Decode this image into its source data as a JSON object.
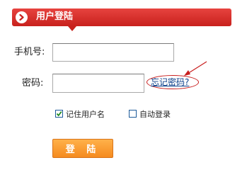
{
  "header": {
    "title": "用户登陆",
    "icon": "arrow-right-circle-icon"
  },
  "form": {
    "phone_label": "手机号:",
    "phone_value": "",
    "password_label": "密码:",
    "password_value": "",
    "forgot_password_link": "忘记密码?",
    "remember_username_label": "记住用户名",
    "remember_username_checked": true,
    "auto_login_label": "自动登录",
    "auto_login_checked": false,
    "login_button": "登 陆"
  },
  "colors": {
    "header_red": "#d42b27",
    "button_orange": "#f7931e",
    "link_blue": "#0b3f8a",
    "annotation_red": "#c81d1d"
  }
}
